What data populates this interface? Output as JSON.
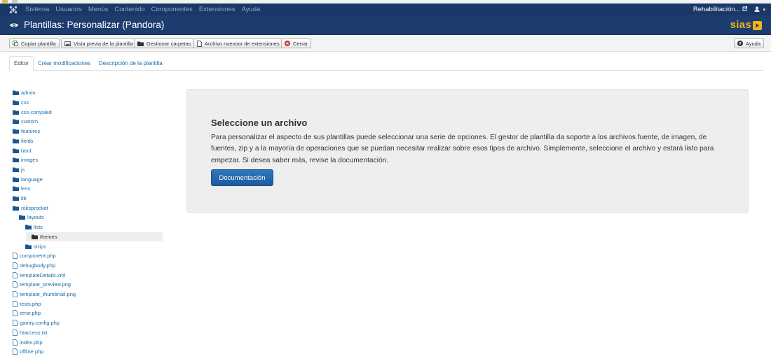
{
  "topnav": {
    "menu": [
      "Sistema",
      "Usuarios",
      "Menús",
      "Contenido",
      "Componentes",
      "Extensiones",
      "Ayuda"
    ],
    "site_link": "Rehabilitación...",
    "icons": [
      "joomla-logo-icon",
      "external-link-icon",
      "user-icon",
      "caret-down-icon"
    ]
  },
  "header": {
    "title": "Plantillas: Personalizar (Pandora)",
    "brand_text": "sias"
  },
  "toolbar": {
    "copy": "Copiar plantilla",
    "preview": "Vista previa de la plantilla",
    "folders": "Gestionar carpetas",
    "new_file": "Archivo nuevoor de extensiones",
    "close": "Cerrar",
    "help": "Ayuda"
  },
  "tabs": [
    "Editor",
    "Crear modificaciones",
    "Descripción de la plantilla"
  ],
  "tree": {
    "folders": [
      "admin",
      "css",
      "css-compiled",
      "custom",
      "features",
      "fields",
      "html",
      "images",
      "js",
      "language",
      "less",
      "lib",
      "roksprocket"
    ],
    "roksprocket_children": [
      "layouts"
    ],
    "layouts_children": [
      "lists",
      "strips"
    ],
    "lists_children": [
      "themes"
    ],
    "files": [
      "component.php",
      "debugbody.php",
      "templateDetails.xml",
      "template_preview.png",
      "template_thumbnail.png",
      "tests.php",
      "error.php",
      "gantry.config.php",
      "htaccess.txt",
      "index.php",
      "offline.php"
    ]
  },
  "panel": {
    "title": "Seleccione un archivo",
    "body": "Para personalizar el aspecto de sus plantillas puede seleccionar una serie de opciones. El gestor de plantilla da soporte a los archivos fuente, de imagen, de fuentes, zip y a la mayoría de operaciones que se puedan necesitar realizar sobre esos tipos de archivo. Simplemente, seleccione el archivo y estará listo para empezar. Si desea saber más, revise la documentación.",
    "button": "Documentación"
  },
  "colors": {
    "nav_bg": "#1a3867",
    "header_bg": "#1c3d6e",
    "brand_accent": "#f1b21c",
    "link": "#1a6dac",
    "primary_button": "#1c5a9e",
    "close_icon": "#c9302c"
  }
}
